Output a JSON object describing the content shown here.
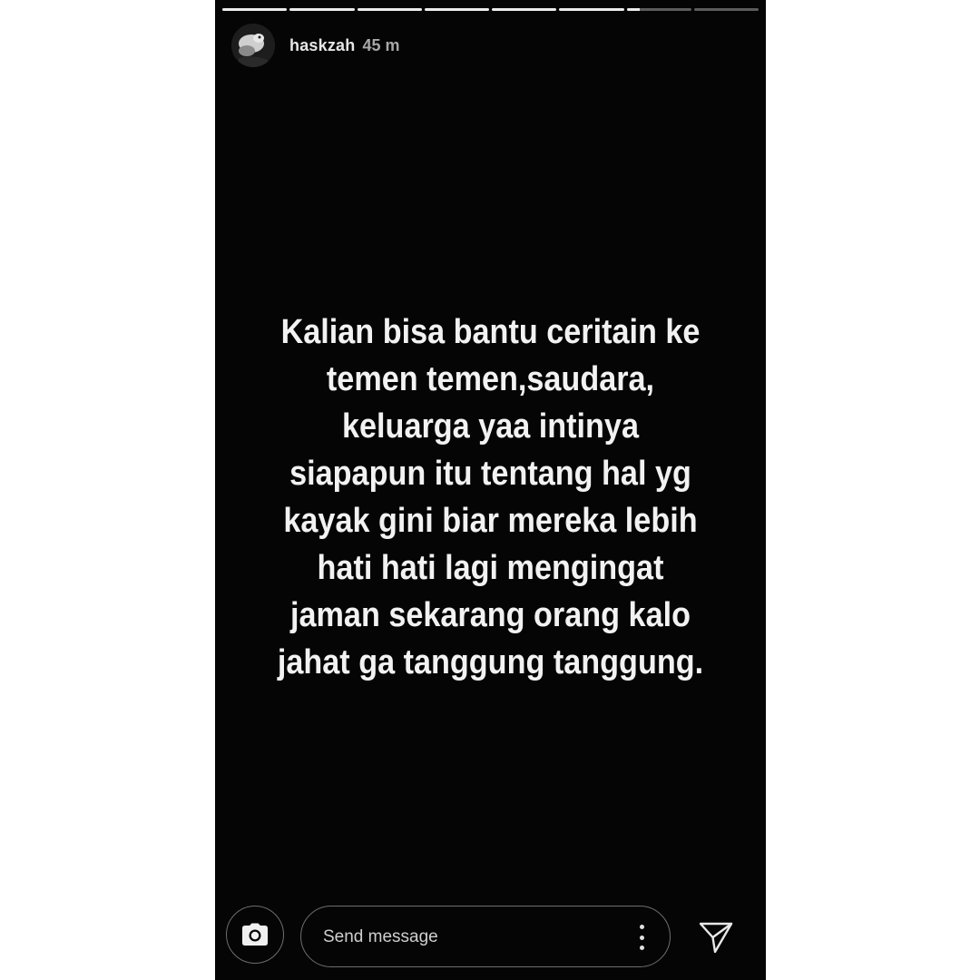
{
  "story": {
    "progress_segments": [
      1,
      1,
      1,
      1,
      1,
      1,
      0.2,
      0
    ],
    "user": {
      "username": "haskzah",
      "time_ago": "45 m"
    },
    "caption_lines": [
      "Kalian bisa bantu ceritain ke",
      "temen temen,saudara,",
      "keluarga yaa intinya",
      "siapapun itu tentang hal yg",
      "kayak gini biar mereka lebih",
      "hati hati lagi mengingat",
      "jaman sekarang orang kalo",
      "jahat ga tanggung tanggung."
    ]
  },
  "footer": {
    "camera_icon": "camera-icon",
    "message_placeholder": "Send message",
    "more_icon": "more-vertical-icon",
    "share_icon": "paper-plane-icon"
  },
  "colors": {
    "story_background": "#050505",
    "page_background": "#ffffff",
    "text": "#f2f2f2",
    "muted_text": "#a8a8a8"
  }
}
